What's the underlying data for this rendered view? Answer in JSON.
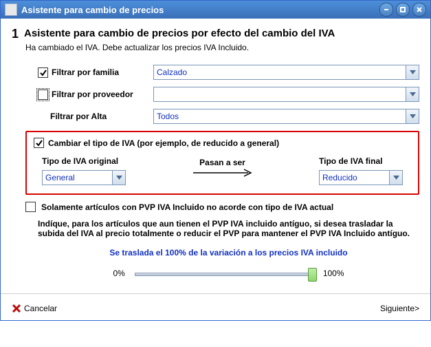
{
  "window": {
    "title": "Asistente para cambio de precios"
  },
  "step": {
    "number": "1",
    "title": "Asistente para cambio de precios por efecto del cambio del IVA",
    "subtitle": "Ha cambiado el IVA. Debe actualizar los precios IVA Incluido."
  },
  "filters": {
    "family": {
      "label": "Filtrar por familia",
      "checked": true,
      "value": "Calzado"
    },
    "provider": {
      "label": "Filtrar por proveedor",
      "checked": false,
      "value": ""
    },
    "alta": {
      "label": "Filtrar por Alta",
      "value": "Todos"
    }
  },
  "iva_change": {
    "checked": true,
    "label": "Cambiar el tipo de IVA (por ejemplo, de reducido a general)",
    "original_label": "Tipo de IVA original",
    "original_value": "General",
    "link_text": "Pasan a ser",
    "final_label": "Tipo de IVA final",
    "final_value": "Reducido"
  },
  "only_pvp": {
    "checked": false,
    "label": "Solamente artículos con PVP IVA Incluido no acorde con tipo de IVA actual"
  },
  "explain": "Indíque, para los artículos que aun tienen el PVP IVA incluido antíguo, si desea trasladar la subida del IVA al precio totalmente o reducir el PVP para mantener el PVP IVA Incluido antíguo.",
  "slider": {
    "caption": "Se traslada el 100% de la variación a los precios IVA incluido",
    "min_label": "0%",
    "max_label": "100%",
    "value_pct": 100
  },
  "footer": {
    "cancel": "Cancelar",
    "next": "Siguiente>"
  }
}
